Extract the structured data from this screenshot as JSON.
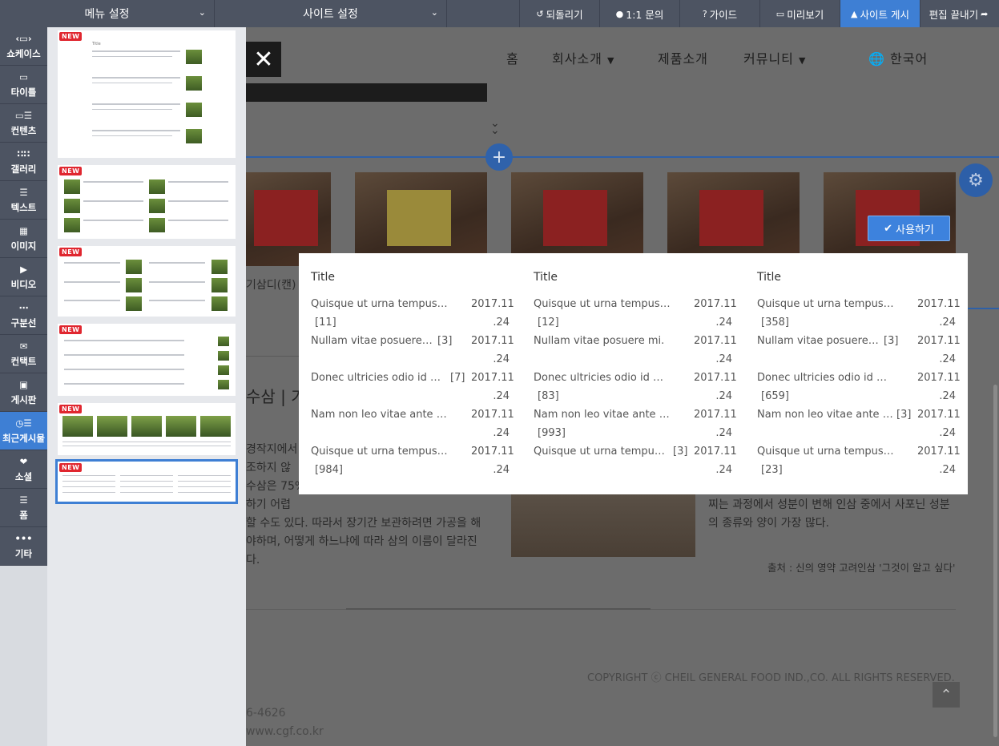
{
  "topbar": {
    "menu_settings": "메뉴 설정",
    "site_settings": "사이트 설정",
    "undo": "되돌리기",
    "inquiry": "1:1 문의",
    "guide": "가이드",
    "preview": "미리보기",
    "publish": "사이트 게시",
    "finish_edit": "편집 끝내기"
  },
  "sidebar": {
    "items": [
      {
        "label": "쇼케이스",
        "icon": "showcase-icon"
      },
      {
        "label": "타이틀",
        "icon": "title-icon"
      },
      {
        "label": "컨텐츠",
        "icon": "content-icon"
      },
      {
        "label": "갤러리",
        "icon": "gallery-icon"
      },
      {
        "label": "텍스트",
        "icon": "text-icon"
      },
      {
        "label": "이미지",
        "icon": "image-icon"
      },
      {
        "label": "비디오",
        "icon": "video-icon"
      },
      {
        "label": "구분선",
        "icon": "divider-icon"
      },
      {
        "label": "컨택트",
        "icon": "contact-icon"
      },
      {
        "label": "게시판",
        "icon": "board-icon"
      },
      {
        "label": "최근게시물",
        "icon": "recent-posts-icon"
      },
      {
        "label": "소셜",
        "icon": "social-icon"
      },
      {
        "label": "폼",
        "icon": "form-icon"
      },
      {
        "label": "기타",
        "icon": "more-icon"
      }
    ],
    "active_index": 10
  },
  "panel": {
    "new_badge": "NEW",
    "thumb_title": "Title"
  },
  "site": {
    "nav": {
      "home": "홈",
      "about": "회사소개",
      "products": "제품소개",
      "community": "커뮤니티",
      "language": "한국어"
    },
    "product_caption": "기삼디(캔)",
    "heading_fragment": "수삼 | 가",
    "left_lines": [
      "경작지에서 수",
      "조하지 않",
      "수삼은 75%",
      "하기 어렵",
      "할 수도 있다. 따라서 장기간 보관하려면 가공을 해",
      "야하며, 어떻게 하느냐에 따라 삼의 이름이 달라진",
      "다."
    ],
    "right_lines": [
      "찌는 과정에서 성분이 변해 인삼 중에서 사포닌 성분",
      "의 종류와 양이 가장 많다."
    ],
    "source": "출처 : 신의 영약 고려인삼 '그것이 알고 싶다'",
    "copyright": "COPYRIGHT ⓒ CHEIL GENERAL FOOD IND.,CO. ALL RIGHTS RESERVED.",
    "phone_fragment": "6-4626",
    "web_fragment": "www.cgf.co.kr",
    "use_button": "사용하기"
  },
  "preview": {
    "columns": [
      {
        "title": "Title",
        "rows": [
          {
            "title": "Quisque ut urna tempus. ...",
            "count": "[11]",
            "date1": "2017.11",
            "date2": ".24"
          },
          {
            "title": "Nullam vitae posuere mi.",
            "count": "[3]",
            "date1": "2017.11",
            "date2": ".24"
          },
          {
            "title": "Donec ultricies odio id mi ...",
            "count": "[7]",
            "date1": "2017.11",
            "date2": ".24"
          },
          {
            "title": "Nam non leo vitae ante a...",
            "count": "",
            "date1": "2017.11",
            "date2": ".24"
          },
          {
            "title": "Quisque ut urna tempus, ...",
            "count": "[984]",
            "date1": "2017.11",
            "date2": ".24"
          }
        ]
      },
      {
        "title": "Title",
        "rows": [
          {
            "title": "Quisque ut urna tempus. ...",
            "count": "[12]",
            "date1": "2017.11",
            "date2": ".24"
          },
          {
            "title": "Nullam vitae posuere mi.",
            "count": "",
            "date1": "2017.11",
            "date2": ".24"
          },
          {
            "title": "Donec ultricies odio id mi ...",
            "count": "[83]",
            "date1": "2017.11",
            "date2": ".24"
          },
          {
            "title": "Nam non leo vitae ante a...",
            "count": "[993]",
            "date1": "2017.11",
            "date2": ".24"
          },
          {
            "title": "Quisque ut urna tempus, ...",
            "count": "[3]",
            "date1": "2017.11",
            "date2": ".24"
          }
        ]
      },
      {
        "title": "Title",
        "rows": [
          {
            "title": "Quisque ut urna tempus. ...",
            "count": "[358]",
            "date1": "2017.11",
            "date2": ".24"
          },
          {
            "title": "Nullam vitae posuere mi.",
            "count": "[3]",
            "date1": "2017.11",
            "date2": ".24"
          },
          {
            "title": "Donec ultricies odio id mi ...",
            "count": "[659]",
            "date1": "2017.11",
            "date2": ".24"
          },
          {
            "title": "Nam non leo vitae ante a...",
            "count": "[3]",
            "date1": "2017.11",
            "date2": ".24"
          },
          {
            "title": "Quisque ut urna tempus, ...",
            "count": "[23]",
            "date1": "2017.11",
            "date2": ".24"
          }
        ]
      }
    ]
  },
  "colors": {
    "topbar": "#4d5462",
    "accent": "#3e7fd4",
    "new_badge": "#e0262f"
  }
}
